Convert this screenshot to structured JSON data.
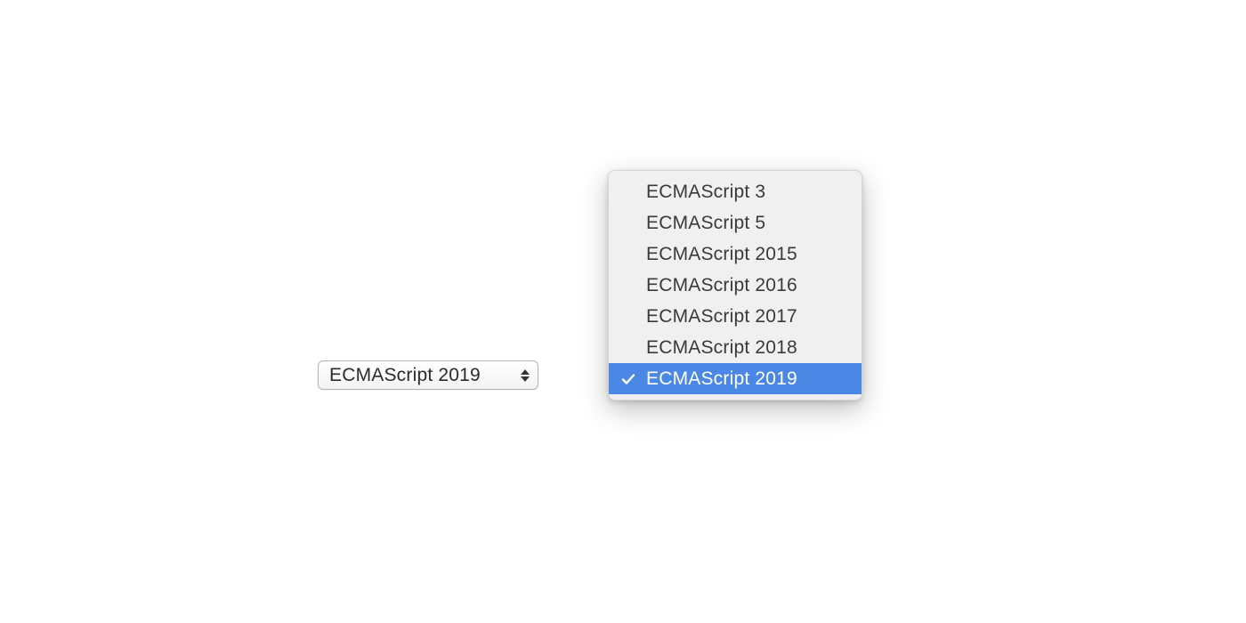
{
  "select": {
    "current": "ECMAScript 2019"
  },
  "dropdown": {
    "items": [
      {
        "label": "ECMAScript 3",
        "selected": false
      },
      {
        "label": "ECMAScript 5",
        "selected": false
      },
      {
        "label": "ECMAScript 2015",
        "selected": false
      },
      {
        "label": "ECMAScript 2016",
        "selected": false
      },
      {
        "label": "ECMAScript 2017",
        "selected": false
      },
      {
        "label": "ECMAScript 2018",
        "selected": false
      },
      {
        "label": "ECMAScript 2019",
        "selected": true
      }
    ]
  },
  "colors": {
    "highlight": "#4b88e6",
    "menu_bg": "#f0f0f0"
  }
}
